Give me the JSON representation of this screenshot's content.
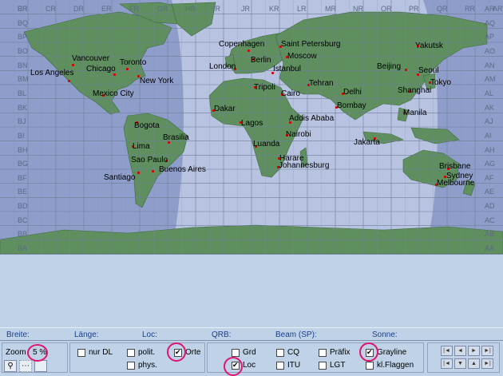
{
  "map": {
    "grid_top_letters": [
      "BR",
      "CR",
      "DR",
      "ER",
      "FR",
      "GR",
      "HR",
      "IR",
      "JR",
      "KR",
      "LR",
      "MR",
      "NR",
      "OR",
      "PR",
      "QR",
      "RR",
      "AR"
    ],
    "grid_left_letters": [
      "BR",
      "BQ",
      "BP",
      "BO",
      "BN",
      "BM",
      "BL",
      "BK",
      "BJ",
      "BI",
      "BH",
      "BG",
      "BF",
      "BE",
      "BD",
      "BC",
      "BB",
      "BA"
    ],
    "grid_right_letters": [
      "AR",
      "AQ",
      "AP",
      "AO",
      "AN",
      "AM",
      "AL",
      "AK",
      "AJ",
      "AI",
      "AH",
      "AG",
      "AF",
      "AE",
      "AD",
      "AC",
      "AB",
      "AA"
    ],
    "cities": [
      {
        "name": "Vancouver",
        "dot": [
          90,
          80
        ]
      },
      {
        "name": "Toronto",
        "dot": [
          158,
          85
        ]
      },
      {
        "name": "Los Angeles",
        "dot": [
          85,
          100
        ]
      },
      {
        "name": "Chicago",
        "dot": [
          142,
          92
        ]
      },
      {
        "name": "New York",
        "dot": [
          172,
          94
        ]
      },
      {
        "name": "Mexico City",
        "dot": [
          128,
          118
        ]
      },
      {
        "name": "Bogota",
        "dot": [
          170,
          152
        ]
      },
      {
        "name": "Lima",
        "dot": [
          165,
          182
        ]
      },
      {
        "name": "Brasilia",
        "dot": [
          210,
          177
        ]
      },
      {
        "name": "Sao Paulo",
        "dot": [
          207,
          200
        ]
      },
      {
        "name": "Buenos Aires",
        "dot": [
          190,
          213
        ]
      },
      {
        "name": "Santiago",
        "dot": [
          172,
          215
        ]
      },
      {
        "name": "Copenhagen",
        "dot": [
          310,
          62
        ]
      },
      {
        "name": "Saint Petersburg",
        "dot": [
          350,
          57
        ]
      },
      {
        "name": "Berlin",
        "dot": [
          316,
          73
        ]
      },
      {
        "name": "Moscow",
        "dot": [
          358,
          70
        ]
      },
      {
        "name": "London",
        "dot": [
          293,
          85
        ]
      },
      {
        "name": "Istanbul",
        "dot": [
          340,
          90
        ]
      },
      {
        "name": "Tripoli",
        "dot": [
          318,
          108
        ]
      },
      {
        "name": "Cairo",
        "dot": [
          352,
          117
        ]
      },
      {
        "name": "Tehran",
        "dot": [
          385,
          105
        ]
      },
      {
        "name": "Dakar",
        "dot": [
          266,
          137
        ]
      },
      {
        "name": "Lagos",
        "dot": [
          300,
          152
        ]
      },
      {
        "name": "Addis Ababa",
        "dot": [
          362,
          152
        ]
      },
      {
        "name": "Nairobi",
        "dot": [
          358,
          168
        ]
      },
      {
        "name": "Luanda",
        "dot": [
          319,
          182
        ]
      },
      {
        "name": "Harare",
        "dot": [
          348,
          197
        ]
      },
      {
        "name": "Johannesburg",
        "dot": [
          347,
          208
        ]
      },
      {
        "name": "Delhi",
        "dot": [
          428,
          116
        ]
      },
      {
        "name": "Bombay",
        "dot": [
          420,
          133
        ]
      },
      {
        "name": "Beijing",
        "dot": [
          507,
          86
        ]
      },
      {
        "name": "Seoul",
        "dot": [
          522,
          92
        ]
      },
      {
        "name": "Yakutsk",
        "dot": [
          522,
          56
        ]
      },
      {
        "name": "Tokyo",
        "dot": [
          537,
          102
        ]
      },
      {
        "name": "Shanghai",
        "dot": [
          512,
          113
        ]
      },
      {
        "name": "Manila",
        "dot": [
          505,
          140
        ]
      },
      {
        "name": "Jakarta",
        "dot": [
          468,
          172
        ]
      },
      {
        "name": "Brisbane",
        "dot": [
          560,
          210
        ]
      },
      {
        "name": "Sydney",
        "dot": [
          556,
          220
        ]
      },
      {
        "name": "Melbourne",
        "dot": [
          545,
          230
        ]
      }
    ]
  },
  "status": {
    "breite": "Breite:",
    "laenge": "Länge:",
    "loc": "Loc:",
    "qrb": "QRB:",
    "beam": "Beam (SP):",
    "sonne": "Sonne:"
  },
  "controls": {
    "zoom_label": "Zoom",
    "zoom_value": "5 %",
    "nur_dl": "nur DL",
    "polit": "polit.",
    "phys": "phys.",
    "orte": "Orte",
    "grd": "Grd",
    "loc": "Loc",
    "cq": "CQ",
    "itu": "ITU",
    "praefix": "Präfix",
    "lgt": "LGT",
    "grayline": "Grayline",
    "kl_flaggen": "kl.Flaggen",
    "checked": {
      "nur_dl": false,
      "polit": false,
      "phys": false,
      "orte": true,
      "grd": false,
      "loc": true,
      "cq": false,
      "itu": false,
      "praefix": false,
      "lgt": false,
      "grayline": true,
      "kl_flaggen": false
    },
    "nav_buttons_top": [
      "|◄",
      "◄",
      "►",
      "►|"
    ],
    "nav_buttons_bottom": [
      "|◄",
      "▼",
      "▲",
      "►|"
    ]
  },
  "colors": {
    "land": "#5f8f5f",
    "ocean_night": "#8e9dc9",
    "ocean_day": "#b9c4e0",
    "highlight": "#e0146c"
  }
}
